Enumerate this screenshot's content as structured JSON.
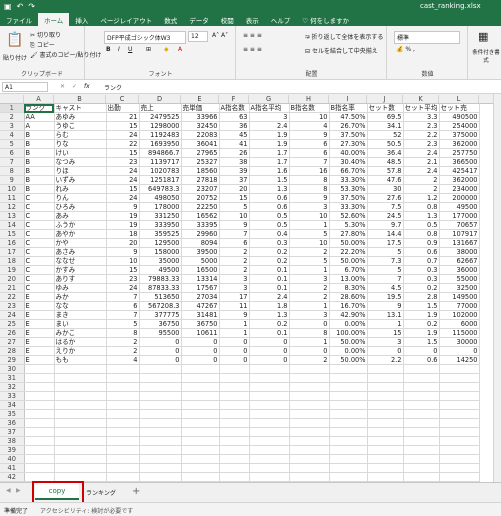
{
  "titlebar": {
    "save_icon": "save-icon",
    "undo": "↶",
    "redo": "↷",
    "filename": "cast_ranking.xlsx"
  },
  "tabs": [
    "ファイル",
    "ホーム",
    "挿入",
    "ページレイアウト",
    "数式",
    "データ",
    "校閲",
    "表示",
    "ヘルプ",
    "♡ 何をしますか"
  ],
  "ribbon": {
    "paste": "貼り付け",
    "cut": "切り取り",
    "copy": "コピー",
    "format_painter": "書式のコピー/貼り付け",
    "clipboard_label": "クリップボード",
    "font_name": "DFP平成ゴシック体W3",
    "font_size": "12",
    "font_label": "フォント",
    "wrap": "折り返して全体を表示する",
    "merge": "セルを結合して中央揃え",
    "align_label": "配置",
    "number_format": "標準",
    "number_label": "数値",
    "cond_format": "条件付き書式"
  },
  "formula": {
    "cell_ref": "A1",
    "fx": "fx",
    "value": "ランク"
  },
  "columns": [
    "A",
    "B",
    "C",
    "D",
    "E",
    "F",
    "G",
    "H",
    "I",
    "J",
    "K",
    "L"
  ],
  "rows": [
    [
      "ランク",
      "キャスト",
      "出勤",
      "売上",
      "売単価",
      "A指名数",
      "A指名平均",
      "B指名数",
      "B指名率",
      "セット数",
      "セット平均",
      "セット売"
    ],
    [
      "AA",
      "あゆみ",
      "21",
      "2479525",
      "33966",
      "63",
      "3",
      "10",
      "47.50%",
      "69.5",
      "3.3",
      "490500"
    ],
    [
      "A",
      "うゆこ",
      "15",
      "1298000",
      "32450",
      "36",
      "2.4",
      "4",
      "26.70%",
      "34.1",
      "2.3",
      "254000"
    ],
    [
      "B",
      "らむ",
      "24",
      "1192483",
      "22083",
      "45",
      "1.9",
      "9",
      "37.50%",
      "52",
      "2.2",
      "375000"
    ],
    [
      "B",
      "りな",
      "22",
      "1693950",
      "36041",
      "41",
      "1.9",
      "6",
      "27.30%",
      "50.5",
      "2.3",
      "362000"
    ],
    [
      "B",
      "けい",
      "15",
      "894866.7",
      "27965",
      "26",
      "1.7",
      "6",
      "40.00%",
      "36.4",
      "2.4",
      "257750"
    ],
    [
      "B",
      "なつみ",
      "23",
      "1139717",
      "25327",
      "38",
      "1.7",
      "7",
      "30.40%",
      "48.5",
      "2.1",
      "366500"
    ],
    [
      "B",
      "りほ",
      "24",
      "1020783",
      "18560",
      "39",
      "1.6",
      "16",
      "66.70%",
      "57.8",
      "2.4",
      "425417"
    ],
    [
      "B",
      "いずみ",
      "24",
      "1251817",
      "27818",
      "37",
      "1.5",
      "8",
      "33.30%",
      "47.6",
      "2",
      "362000"
    ],
    [
      "B",
      "れみ",
      "15",
      "649783.3",
      "23207",
      "20",
      "1.3",
      "8",
      "53.30%",
      "30",
      "2",
      "234000"
    ],
    [
      "C",
      "りん",
      "24",
      "498050",
      "20752",
      "15",
      "0.6",
      "9",
      "37.50%",
      "27.6",
      "1.2",
      "200000"
    ],
    [
      "C",
      "ひろみ",
      "9",
      "178000",
      "22250",
      "5",
      "0.6",
      "3",
      "33.30%",
      "7.5",
      "0.8",
      "49500"
    ],
    [
      "C",
      "あみ",
      "19",
      "331250",
      "16562",
      "10",
      "0.5",
      "10",
      "52.60%",
      "24.5",
      "1.3",
      "177000"
    ],
    [
      "C",
      "ふうか",
      "19",
      "333950",
      "33395",
      "9",
      "0.5",
      "1",
      "5.30%",
      "9.7",
      "0.5",
      "70657"
    ],
    [
      "C",
      "あやか",
      "18",
      "359525",
      "29960",
      "7",
      "0.4",
      "5",
      "27.80%",
      "14.4",
      "0.8",
      "107917"
    ],
    [
      "C",
      "かや",
      "20",
      "129500",
      "8094",
      "6",
      "0.3",
      "10",
      "50.00%",
      "17.5",
      "0.9",
      "131667"
    ],
    [
      "C",
      "あさみ",
      "9",
      "158000",
      "39500",
      "2",
      "0.2",
      "2",
      "22.20%",
      "5",
      "0.6",
      "38000"
    ],
    [
      "C",
      "ななせ",
      "10",
      "35000",
      "5000",
      "2",
      "0.2",
      "5",
      "50.00%",
      "7.3",
      "0.7",
      "62667"
    ],
    [
      "C",
      "かすみ",
      "15",
      "49500",
      "16500",
      "2",
      "0.1",
      "1",
      "6.70%",
      "5",
      "0.3",
      "36000"
    ],
    [
      "C",
      "ありす",
      "23",
      "79883.33",
      "13314",
      "3",
      "0.1",
      "3",
      "13.00%",
      "7",
      "0.3",
      "55000"
    ],
    [
      "C",
      "ゆみ",
      "24",
      "87833.33",
      "17567",
      "3",
      "0.1",
      "2",
      "8.30%",
      "4.5",
      "0.2",
      "32500"
    ],
    [
      "E",
      "みか",
      "7",
      "513650",
      "27034",
      "17",
      "2.4",
      "2",
      "28.60%",
      "19.5",
      "2.8",
      "149500"
    ],
    [
      "E",
      "なな",
      "6",
      "567208.3",
      "47267",
      "11",
      "1.8",
      "1",
      "16.70%",
      "9",
      "1.5",
      "77000"
    ],
    [
      "E",
      "まき",
      "7",
      "377775",
      "31481",
      "9",
      "1.3",
      "3",
      "42.90%",
      "13.1",
      "1.9",
      "102000"
    ],
    [
      "E",
      "まい",
      "5",
      "36750",
      "36750",
      "1",
      "0.2",
      "0",
      "0.00%",
      "1",
      "0.2",
      "6000"
    ],
    [
      "E",
      "みかこ",
      "8",
      "95500",
      "10611",
      "1",
      "0.1",
      "8",
      "100.00%",
      "15",
      "1.9",
      "115000"
    ],
    [
      "E",
      "はるか",
      "2",
      "0",
      "0",
      "0",
      "0",
      "1",
      "50.00%",
      "3",
      "1.5",
      "30000"
    ],
    [
      "E",
      "えりか",
      "2",
      "0",
      "0",
      "0",
      "0",
      "0",
      "0.00%",
      "0",
      "0",
      "0"
    ],
    [
      "E",
      "もも",
      "4",
      "0",
      "0",
      "0",
      "0",
      "2",
      "50.00%",
      "2.2",
      "0.6",
      "14250"
    ]
  ],
  "total_rows": 45,
  "sheets": {
    "active": "copy",
    "other": "ランキング",
    "add": "+"
  },
  "status": {
    "ready": "準備完了",
    "accessibility": "アクセシビリティ: 検討が必要です"
  },
  "colors": {
    "accent": "#217346",
    "highlight": "#d00000"
  }
}
